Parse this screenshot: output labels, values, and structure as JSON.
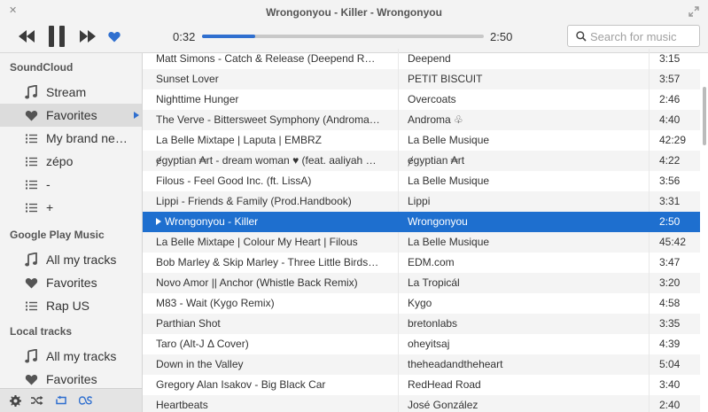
{
  "window": {
    "title": "Wrongonyou - Killer - Wrongonyou",
    "close_glyph": "✕"
  },
  "player": {
    "elapsed": "0:32",
    "total": "2:50",
    "progress": 0.188,
    "favorited": true,
    "accent_color": "#2f6fcf"
  },
  "search": {
    "placeholder": "Search for music",
    "value": ""
  },
  "sidebar": {
    "sections": [
      {
        "title": "SoundCloud",
        "items": [
          {
            "label": "Stream",
            "icon": "music-note-icon"
          },
          {
            "label": "Favorites",
            "icon": "heart-icon",
            "selected": true
          },
          {
            "label": "My brand ne…",
            "icon": "playlist-icon"
          },
          {
            "label": "zépo",
            "icon": "playlist-icon"
          },
          {
            "label": "-",
            "icon": "playlist-icon"
          },
          {
            "label": "+",
            "icon": "playlist-icon"
          }
        ]
      },
      {
        "title": "Google Play Music",
        "items": [
          {
            "label": "All my tracks",
            "icon": "music-note-icon"
          },
          {
            "label": "Favorites",
            "icon": "heart-icon"
          },
          {
            "label": "Rap US",
            "icon": "playlist-icon"
          }
        ]
      },
      {
        "title": "Local tracks",
        "items": [
          {
            "label": "All my tracks",
            "icon": "music-note-icon"
          },
          {
            "label": "Favorites",
            "icon": "heart-icon"
          }
        ]
      }
    ]
  },
  "footer": {
    "buttons": [
      "gear-icon",
      "shuffle-icon",
      "repeat-icon",
      "lastfm-icon"
    ]
  },
  "tracks": [
    {
      "title": "Matt Simons - Catch & Release (Deepend R…",
      "artist": "Deepend",
      "duration": "3:15"
    },
    {
      "title": "Sunset Lover",
      "artist": "PETIT BISCUIT",
      "duration": "3:57"
    },
    {
      "title": "Nighttime Hunger",
      "artist": "Overcoats",
      "duration": "2:46"
    },
    {
      "title": "The Verve - Bittersweet Symphony (Androma…",
      "artist": "Androma ♧",
      "duration": "4:40"
    },
    {
      "title": "La Belle Mixtape | Laputa | EMBRZ",
      "artist": "La Belle Musique",
      "duration": "42:29"
    },
    {
      "title": "ɇgyptian ₳rt - dream woman ♥ (feat. aaliyah …",
      "artist": "ɇgyptian ₳rt",
      "duration": "4:22"
    },
    {
      "title": "Filous - Feel Good Inc. (ft. LissA)",
      "artist": "La Belle Musique",
      "duration": "3:56"
    },
    {
      "title": "Lippi - Friends & Family (Prod.Handbook)",
      "artist": "Lippi",
      "duration": "3:31"
    },
    {
      "title": "Wrongonyou - Killer",
      "artist": "Wrongonyou",
      "duration": "2:50",
      "playing": true
    },
    {
      "title": "La Belle Mixtape | Colour My Heart | Filous",
      "artist": "La Belle Musique",
      "duration": "45:42"
    },
    {
      "title": "Bob Marley & Skip Marley - Three Little Birds…",
      "artist": "EDM.com",
      "duration": "3:47"
    },
    {
      "title": "Novo Amor || Anchor (Whistle Back Remix)",
      "artist": "La Tropicál",
      "duration": "3:20"
    },
    {
      "title": "M83 - Wait (Kygo Remix)",
      "artist": "Kygo",
      "duration": "4:58"
    },
    {
      "title": "Parthian Shot",
      "artist": "bretonlabs",
      "duration": "3:35"
    },
    {
      "title": "Taro (Alt-J Δ Cover)",
      "artist": "oheyitsaj",
      "duration": "4:39"
    },
    {
      "title": "Down in the Valley",
      "artist": "theheadandtheheart",
      "duration": "5:04"
    },
    {
      "title": "Gregory Alan Isakov - Big Black Car",
      "artist": "RedHead Road",
      "duration": "3:40"
    },
    {
      "title": "Heartbeats",
      "artist": "José González",
      "duration": "2:40"
    }
  ]
}
